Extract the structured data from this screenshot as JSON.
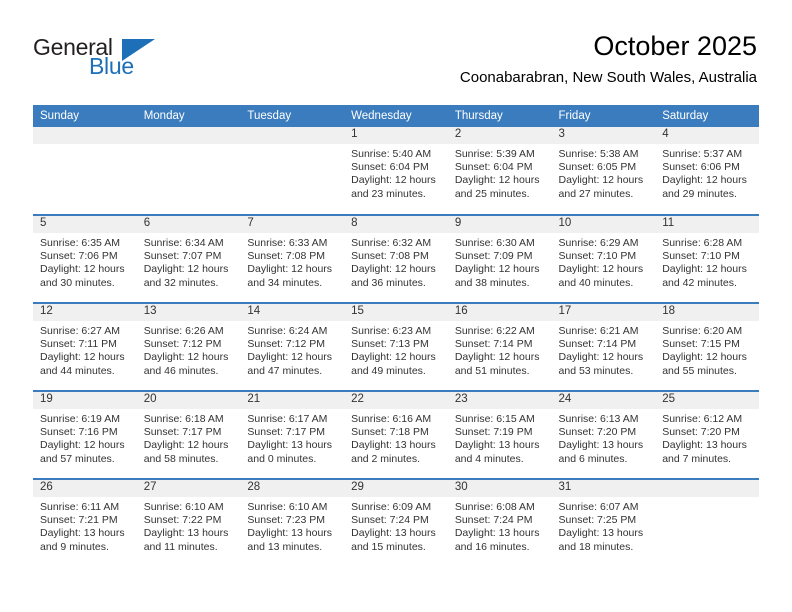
{
  "logo": {
    "text_top": "General",
    "text_bottom": "Blue",
    "triangle_color": "#1d6fb8",
    "text_color": "#231f20"
  },
  "header": {
    "title": "October 2025",
    "subtitle": "Coonabarabran, New South Wales, Australia"
  },
  "colors": {
    "header_blue": "#3a7cbe",
    "daynum_band": "#f0f0f0",
    "text": "#333333"
  },
  "weekdays": [
    "Sunday",
    "Monday",
    "Tuesday",
    "Wednesday",
    "Thursday",
    "Friday",
    "Saturday"
  ],
  "weeks": [
    [
      {
        "day": "",
        "lines": []
      },
      {
        "day": "",
        "lines": []
      },
      {
        "day": "",
        "lines": []
      },
      {
        "day": "1",
        "lines": [
          "Sunrise: 5:40 AM",
          "Sunset: 6:04 PM",
          "Daylight: 12 hours",
          "and 23 minutes."
        ]
      },
      {
        "day": "2",
        "lines": [
          "Sunrise: 5:39 AM",
          "Sunset: 6:04 PM",
          "Daylight: 12 hours",
          "and 25 minutes."
        ]
      },
      {
        "day": "3",
        "lines": [
          "Sunrise: 5:38 AM",
          "Sunset: 6:05 PM",
          "Daylight: 12 hours",
          "and 27 minutes."
        ]
      },
      {
        "day": "4",
        "lines": [
          "Sunrise: 5:37 AM",
          "Sunset: 6:06 PM",
          "Daylight: 12 hours",
          "and 29 minutes."
        ]
      }
    ],
    [
      {
        "day": "5",
        "lines": [
          "Sunrise: 6:35 AM",
          "Sunset: 7:06 PM",
          "Daylight: 12 hours",
          "and 30 minutes."
        ]
      },
      {
        "day": "6",
        "lines": [
          "Sunrise: 6:34 AM",
          "Sunset: 7:07 PM",
          "Daylight: 12 hours",
          "and 32 minutes."
        ]
      },
      {
        "day": "7",
        "lines": [
          "Sunrise: 6:33 AM",
          "Sunset: 7:08 PM",
          "Daylight: 12 hours",
          "and 34 minutes."
        ]
      },
      {
        "day": "8",
        "lines": [
          "Sunrise: 6:32 AM",
          "Sunset: 7:08 PM",
          "Daylight: 12 hours",
          "and 36 minutes."
        ]
      },
      {
        "day": "9",
        "lines": [
          "Sunrise: 6:30 AM",
          "Sunset: 7:09 PM",
          "Daylight: 12 hours",
          "and 38 minutes."
        ]
      },
      {
        "day": "10",
        "lines": [
          "Sunrise: 6:29 AM",
          "Sunset: 7:10 PM",
          "Daylight: 12 hours",
          "and 40 minutes."
        ]
      },
      {
        "day": "11",
        "lines": [
          "Sunrise: 6:28 AM",
          "Sunset: 7:10 PM",
          "Daylight: 12 hours",
          "and 42 minutes."
        ]
      }
    ],
    [
      {
        "day": "12",
        "lines": [
          "Sunrise: 6:27 AM",
          "Sunset: 7:11 PM",
          "Daylight: 12 hours",
          "and 44 minutes."
        ]
      },
      {
        "day": "13",
        "lines": [
          "Sunrise: 6:26 AM",
          "Sunset: 7:12 PM",
          "Daylight: 12 hours",
          "and 46 minutes."
        ]
      },
      {
        "day": "14",
        "lines": [
          "Sunrise: 6:24 AM",
          "Sunset: 7:12 PM",
          "Daylight: 12 hours",
          "and 47 minutes."
        ]
      },
      {
        "day": "15",
        "lines": [
          "Sunrise: 6:23 AM",
          "Sunset: 7:13 PM",
          "Daylight: 12 hours",
          "and 49 minutes."
        ]
      },
      {
        "day": "16",
        "lines": [
          "Sunrise: 6:22 AM",
          "Sunset: 7:14 PM",
          "Daylight: 12 hours",
          "and 51 minutes."
        ]
      },
      {
        "day": "17",
        "lines": [
          "Sunrise: 6:21 AM",
          "Sunset: 7:14 PM",
          "Daylight: 12 hours",
          "and 53 minutes."
        ]
      },
      {
        "day": "18",
        "lines": [
          "Sunrise: 6:20 AM",
          "Sunset: 7:15 PM",
          "Daylight: 12 hours",
          "and 55 minutes."
        ]
      }
    ],
    [
      {
        "day": "19",
        "lines": [
          "Sunrise: 6:19 AM",
          "Sunset: 7:16 PM",
          "Daylight: 12 hours",
          "and 57 minutes."
        ]
      },
      {
        "day": "20",
        "lines": [
          "Sunrise: 6:18 AM",
          "Sunset: 7:17 PM",
          "Daylight: 12 hours",
          "and 58 minutes."
        ]
      },
      {
        "day": "21",
        "lines": [
          "Sunrise: 6:17 AM",
          "Sunset: 7:17 PM",
          "Daylight: 13 hours",
          "and 0 minutes."
        ]
      },
      {
        "day": "22",
        "lines": [
          "Sunrise: 6:16 AM",
          "Sunset: 7:18 PM",
          "Daylight: 13 hours",
          "and 2 minutes."
        ]
      },
      {
        "day": "23",
        "lines": [
          "Sunrise: 6:15 AM",
          "Sunset: 7:19 PM",
          "Daylight: 13 hours",
          "and 4 minutes."
        ]
      },
      {
        "day": "24",
        "lines": [
          "Sunrise: 6:13 AM",
          "Sunset: 7:20 PM",
          "Daylight: 13 hours",
          "and 6 minutes."
        ]
      },
      {
        "day": "25",
        "lines": [
          "Sunrise: 6:12 AM",
          "Sunset: 7:20 PM",
          "Daylight: 13 hours",
          "and 7 minutes."
        ]
      }
    ],
    [
      {
        "day": "26",
        "lines": [
          "Sunrise: 6:11 AM",
          "Sunset: 7:21 PM",
          "Daylight: 13 hours",
          "and 9 minutes."
        ]
      },
      {
        "day": "27",
        "lines": [
          "Sunrise: 6:10 AM",
          "Sunset: 7:22 PM",
          "Daylight: 13 hours",
          "and 11 minutes."
        ]
      },
      {
        "day": "28",
        "lines": [
          "Sunrise: 6:10 AM",
          "Sunset: 7:23 PM",
          "Daylight: 13 hours",
          "and 13 minutes."
        ]
      },
      {
        "day": "29",
        "lines": [
          "Sunrise: 6:09 AM",
          "Sunset: 7:24 PM",
          "Daylight: 13 hours",
          "and 15 minutes."
        ]
      },
      {
        "day": "30",
        "lines": [
          "Sunrise: 6:08 AM",
          "Sunset: 7:24 PM",
          "Daylight: 13 hours",
          "and 16 minutes."
        ]
      },
      {
        "day": "31",
        "lines": [
          "Sunrise: 6:07 AM",
          "Sunset: 7:25 PM",
          "Daylight: 13 hours",
          "and 18 minutes."
        ]
      },
      {
        "day": "",
        "lines": []
      }
    ]
  ]
}
